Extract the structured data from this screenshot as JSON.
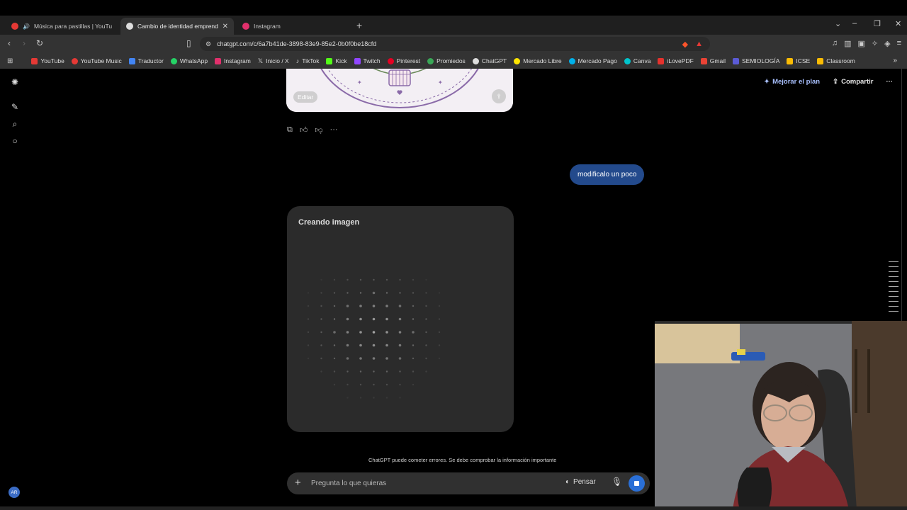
{
  "browser": {
    "tabs": [
      {
        "title": "Música para pastillas | YouTube M",
        "active": false,
        "color": "#e53935"
      },
      {
        "title": "Cambio de identidad emprendim",
        "active": true,
        "color": "#dddddd"
      },
      {
        "title": "Instagram",
        "active": false,
        "color": "#e1306c"
      }
    ],
    "url": "chatgpt.com/c/6a7b41de-3898-83e9-85e2-0b0f0be18cfd",
    "bookmarks": [
      {
        "label": "YouTube",
        "color": "#e53935"
      },
      {
        "label": "YouTube Music",
        "color": "#e53935"
      },
      {
        "label": "Traductor",
        "color": "#4285f4"
      },
      {
        "label": "WhatsApp",
        "color": "#25d366"
      },
      {
        "label": "Instagram",
        "color": "#e1306c"
      },
      {
        "label": "Inicio / X",
        "color": "#ffffff"
      },
      {
        "label": "TikTok",
        "color": "#ffffff"
      },
      {
        "label": "Kick",
        "color": "#53fc18"
      },
      {
        "label": "Twitch",
        "color": "#9146ff"
      },
      {
        "label": "Pinterest",
        "color": "#e60023"
      },
      {
        "label": "Promiedos",
        "color": "#3aa757"
      },
      {
        "label": "ChatGPT",
        "color": "#dddddd"
      },
      {
        "label": "Mercado Libre",
        "color": "#ffe600"
      },
      {
        "label": "Mercado Pago",
        "color": "#00b1ea"
      },
      {
        "label": "Canva",
        "color": "#00c4cc"
      },
      {
        "label": "iLovePDF",
        "color": "#e5322d"
      },
      {
        "label": "Gmail",
        "color": "#ea4335"
      },
      {
        "label": "SEMIOLOGÍA",
        "color": "#5b5bd6"
      },
      {
        "label": "ICSE",
        "color": "#fbbc04"
      },
      {
        "label": "Classroom",
        "color": "#fbbc04"
      }
    ]
  },
  "header": {
    "upgrade_label": "Mejorar el plan",
    "share_label": "Compartir"
  },
  "image_card": {
    "edit_label": "Editar"
  },
  "user_message": "modificalo un poco",
  "generating": {
    "title": "Creando imagen"
  },
  "disclaimer": "ChatGPT puede cometer errores. Se debe comprobar la información importante",
  "composer": {
    "placeholder": "Pregunta lo que quieras",
    "think_label": "Pensar"
  },
  "user": {
    "initials": "AR"
  },
  "colors": {
    "accent": "#2a6fd6",
    "user_bubble": "#234a8c",
    "upgrade": "#a9c0ff"
  }
}
